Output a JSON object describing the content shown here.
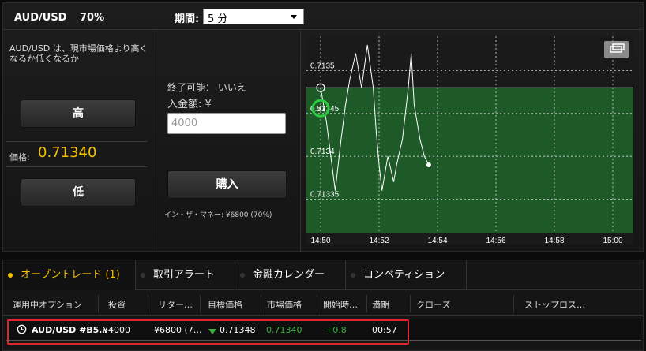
{
  "header": {
    "symbol": "AUD/USD",
    "payout": "70%",
    "period_label": "期間:",
    "period_value": "5 分"
  },
  "option_panel": {
    "description": "AUD/USD は、現市場価格より高くなるか低くなるか",
    "high_label": "高",
    "low_label": "低",
    "price_label": "価格:",
    "price_value": "0.71340"
  },
  "order_panel": {
    "expiry_text": "終了可能： いいえ",
    "deposit_label": "入金額: ¥",
    "amount_placeholder": "4000",
    "buy_label": "購入",
    "in_money_text": "イン・ザ・マネー: ¥6800 (70%)"
  },
  "chart": {
    "target_marker": "57",
    "colors": {
      "green_zone": "#1e5a28",
      "line": "#ffffff",
      "grid": "#d8d8d8"
    }
  },
  "chart_data": {
    "type": "line",
    "y_ticks": [
      "0.7135",
      "0.71345",
      "0.7134",
      "0.71335"
    ],
    "x_ticks": [
      "14:50",
      "14:52",
      "14:54",
      "14:56",
      "14:58",
      "15:00"
    ],
    "ylim": [
      0.71331,
      0.71354
    ],
    "target_level": 0.71348,
    "start_time": "14:50",
    "x_minutes": [
      0,
      0.2,
      0.35,
      0.5,
      0.7,
      0.85,
      1.0,
      1.2,
      1.4,
      1.6,
      1.8,
      1.9,
      2.0,
      2.1,
      2.3,
      2.5,
      2.6,
      2.8,
      3.0,
      3.1,
      3.2,
      3.4,
      3.55,
      3.7
    ],
    "values": [
      0.71348,
      0.71344,
      0.7134,
      0.71336,
      0.71342,
      0.71346,
      0.71349,
      0.71352,
      0.71348,
      0.71353,
      0.71348,
      0.71343,
      0.71339,
      0.71336,
      0.7134,
      0.71337,
      0.71339,
      0.71342,
      0.71348,
      0.71352,
      0.71346,
      0.71342,
      0.7134,
      0.71339
    ],
    "grid": true
  },
  "tabs": [
    {
      "label": "オープントレード (1)",
      "active": true
    },
    {
      "label": "取引アラート",
      "active": false
    },
    {
      "label": "金融カレンダー",
      "active": false
    },
    {
      "label": "コンペティション",
      "active": false
    }
  ],
  "table": {
    "headers": [
      "運用中オプション",
      "投資",
      "リター…",
      "目標価格",
      "市場価格",
      "開始時…",
      "満期",
      "クローズ",
      "ストップロス…"
    ],
    "row": {
      "option": "AUD/USD #B5…",
      "investment": "¥4000",
      "return": "¥6800 (7…",
      "target_price": "0.71348",
      "market_price": "0.71340",
      "change": "+0.8",
      "expiry": "00:57"
    }
  }
}
